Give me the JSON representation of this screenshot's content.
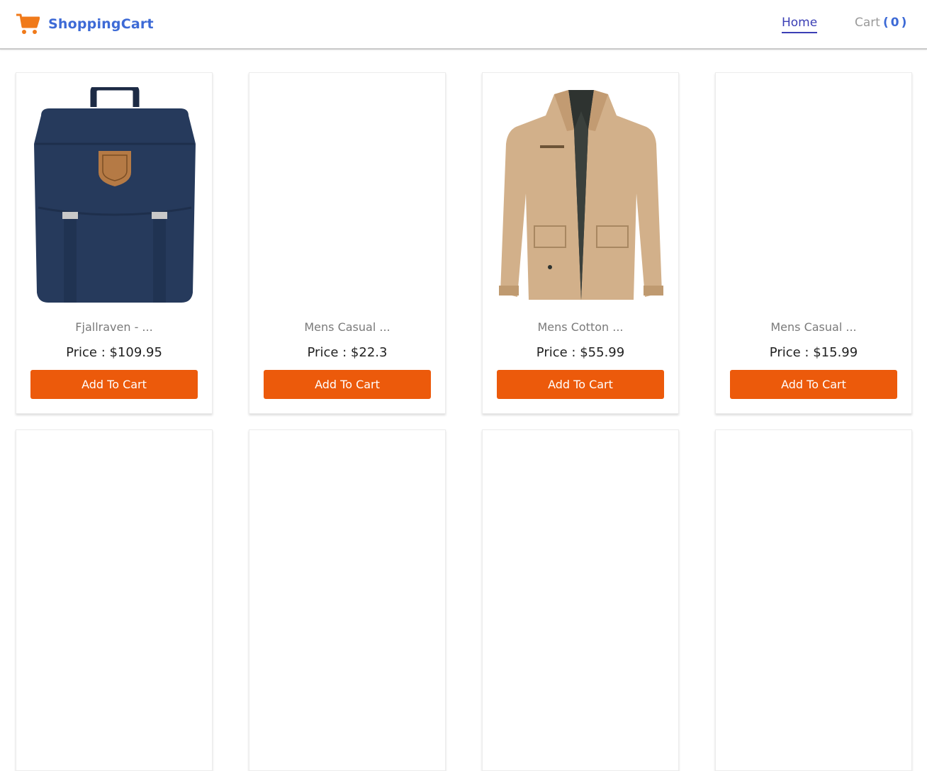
{
  "navbar": {
    "brand": "ShoppingCart",
    "home_label": "Home",
    "cart_label": "Cart",
    "cart_open": "(",
    "cart_count": "0",
    "cart_close": ")"
  },
  "colors": {
    "brand": "#3d6ad6",
    "accent_orange": "#ec5a0b",
    "nav_active": "#3b3fb5"
  },
  "products": [
    {
      "title": "Fjallraven - ...",
      "price": "Price : $109.95",
      "button": "Add To Cart",
      "image": "navy-backpack"
    },
    {
      "title": "Mens Casual ...",
      "price": "Price : $22.3",
      "button": "Add To Cart",
      "image": ""
    },
    {
      "title": "Mens Cotton ...",
      "price": "Price : $55.99",
      "button": "Add To Cart",
      "image": "khaki-jacket"
    },
    {
      "title": "Mens Casual ...",
      "price": "Price : $15.99",
      "button": "Add To Cart",
      "image": ""
    }
  ]
}
